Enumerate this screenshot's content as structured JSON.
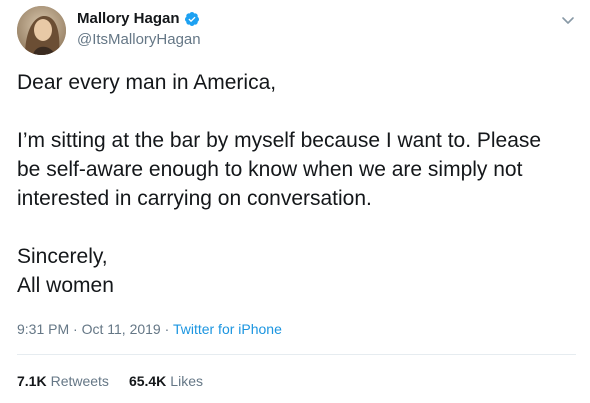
{
  "author": {
    "display_name": "Mallory Hagan",
    "handle": "@ItsMalloryHagan",
    "avatar_icon": "profile-photo",
    "verified_icon": "verified-badge-icon"
  },
  "tweet": {
    "lines": [
      "Dear every man in America,",
      "",
      "I’m sitting at the bar by myself because I want to. Please",
      "be self-aware enough to know when we are simply not",
      "interested in carrying on conversation.",
      "",
      "Sincerely,",
      "All women"
    ],
    "time": "9:31 PM",
    "date": "Oct 11, 2019",
    "separator": "·",
    "source": "Twitter for iPhone"
  },
  "stats": {
    "retweets_count": "7.1K",
    "retweets_label": "Retweets",
    "likes_count": "65.4K",
    "likes_label": "Likes"
  },
  "colors": {
    "text": "#14171a",
    "secondary": "#657786",
    "link": "#1b95e0",
    "verified": "#1da1f2",
    "divider": "#e6ecf0"
  }
}
